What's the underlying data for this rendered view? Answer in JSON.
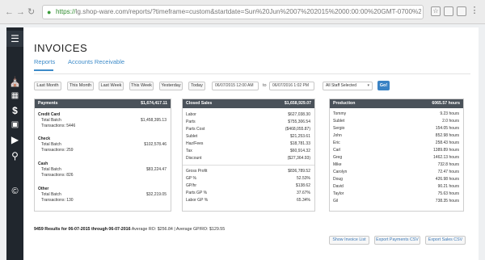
{
  "browser": {
    "url_https": "https://",
    "url_rest": "lg.shop-ware.com/reports/?timeframe=custom&startdate=Sun%20Jun%2007%202015%2000:00:00%20GMT-0700%20(PDT)&enddate=Tue%20Ju..."
  },
  "page": {
    "title": "INVOICES",
    "tabs": [
      "Reports",
      "Accounts Receivable"
    ]
  },
  "filters": {
    "buttons": [
      "Last Month",
      "This Month",
      "Last Week",
      "This Week",
      "Yesterday",
      "Today"
    ],
    "start_date": "06/07/2015 12:00 AM",
    "to_label": "to",
    "end_date": "06/07/2016 1:02 PM",
    "staff_select": "All Staff Selected",
    "go_label": "Go!"
  },
  "payments": {
    "title": "Payments",
    "total": "$1,674,417.11",
    "groups": [
      {
        "name": "Credit Card",
        "batch_label": "Total Batch",
        "batch_value": "$1,458,395.13",
        "transactions_label": "Transactions: 5446"
      },
      {
        "name": "Check",
        "batch_label": "Total Batch",
        "batch_value": "$102,578.46",
        "transactions_label": "Transactions: 259"
      },
      {
        "name": "Cash",
        "batch_label": "Total Batch",
        "batch_value": "$83,224.47",
        "transactions_label": "Transactions: 826"
      },
      {
        "name": "Other",
        "batch_label": "Total Batch",
        "batch_value": "$32,219.05",
        "transactions_label": "Transactions: 130"
      }
    ]
  },
  "closed_sales": {
    "title": "Closed Sales",
    "total": "$1,658,929.07",
    "rows": [
      {
        "label": "Labor",
        "value": "$627,038.30"
      },
      {
        "label": "Parts",
        "value": "$755,306.54"
      },
      {
        "label": "Parts Cost",
        "value": "($468,055.87)"
      },
      {
        "label": "Sublet",
        "value": "$21,253.61"
      },
      {
        "label": "Haz/Fees",
        "value": "$18,781.33"
      },
      {
        "label": "Tax",
        "value": "$60,914.32"
      },
      {
        "label": "Discount",
        "value": "($27,364.93)"
      }
    ],
    "summary": [
      {
        "label": "Gross Profit",
        "value": "$836,789.52"
      },
      {
        "label": "GP %",
        "value": "52.53%"
      },
      {
        "label": "GP/hr",
        "value": "$138.62"
      },
      {
        "label": "Parts GP %",
        "value": "37.67%"
      },
      {
        "label": "Labor GP %",
        "value": "65.34%"
      }
    ]
  },
  "production": {
    "title": "Production",
    "total": "6065.57 hours",
    "rows": [
      {
        "name": "Tommy",
        "value": "9.23 hours"
      },
      {
        "name": "Sublet",
        "value": "2.0 hours"
      },
      {
        "name": "Sergio",
        "value": "154.05 hours"
      },
      {
        "name": "John",
        "value": "852.98 hours"
      },
      {
        "name": "Eric",
        "value": "258.43 hours"
      },
      {
        "name": "Carl",
        "value": "1389.89 hours"
      },
      {
        "name": "Greg",
        "value": "1462.13 hours"
      },
      {
        "name": "Mike",
        "value": "732.8 hours"
      },
      {
        "name": "Carolyn",
        "value": "72.47 hours"
      },
      {
        "name": "Doug",
        "value": "426.98 hours"
      },
      {
        "name": "David",
        "value": "90.21 hours"
      },
      {
        "name": "Taylor",
        "value": "75.63 hours"
      },
      {
        "name": "Gil",
        "value": "738.35 hours"
      }
    ]
  },
  "results": {
    "count_text": "9459 Results for 06-07-2015 through 06-07-2016",
    "averages_text": " Average RO: $256.84 | Average GP/RO: $129.55"
  },
  "exports": [
    "Show Invoice List",
    "Export Payments CSV",
    "Export Sales CSV"
  ],
  "icons": [
    "menu-icon",
    "bank-icon",
    "calendar-icon",
    "dollar-icon",
    "contacts-icon",
    "play-icon",
    "search-icon",
    "copyright-icon"
  ],
  "colors": {
    "accent": "#3d8bc9",
    "sidebar": "#20262d",
    "panel_header": "#4a525a",
    "go_button": "#3a82c4"
  }
}
